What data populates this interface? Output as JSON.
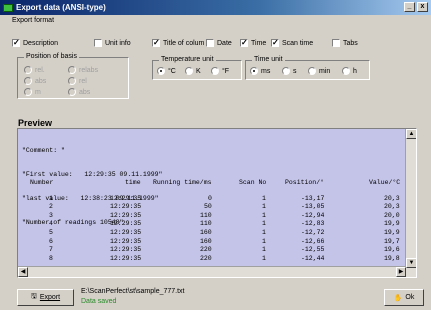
{
  "window": {
    "title": "Export data (ANSI-type)",
    "min": "_",
    "close": "x"
  },
  "menu": {
    "label": "Export format"
  },
  "options": {
    "description": "Description",
    "unit_info": "Unit info",
    "title_of_column": "Title of colum",
    "date": "Date",
    "time": "Time",
    "scan_time": "Scan time",
    "tabs": "Tabs"
  },
  "basis": {
    "title": "Position of basis",
    "items": [
      "rel.",
      "relabs",
      "abs",
      "rel",
      "m",
      "abs"
    ]
  },
  "temp_unit": {
    "title": "Temperature unit",
    "options": [
      "°C",
      "K",
      "°F"
    ],
    "selected": "°C"
  },
  "time_unit": {
    "title": "Time unit",
    "options": [
      "ms",
      "s",
      "min",
      "h"
    ],
    "selected": "ms"
  },
  "preview": {
    "label": "Preview",
    "header_lines": [
      "\"Comment: \"",
      "\"First value:   12:29:35 09.11.1999\"",
      "\"last value:   12:38:23 09.11.1999\"",
      "\"Number of readings 10548\""
    ],
    "columns": [
      "Number",
      "time",
      "Running time/ms",
      "Scan No",
      "Position/°",
      "Value/°C"
    ],
    "rows": [
      [
        "1",
        "12:29:35",
        "0",
        "1",
        "-13,17",
        "20,3"
      ],
      [
        "2",
        "12:29:35",
        "50",
        "1",
        "-13,05",
        "20,3"
      ],
      [
        "3",
        "12:29:35",
        "110",
        "1",
        "-12,94",
        "20,0"
      ],
      [
        "4",
        "12:29:35",
        "110",
        "1",
        "-12,83",
        "19,9"
      ],
      [
        "5",
        "12:29:35",
        "160",
        "1",
        "-12,72",
        "19,9"
      ],
      [
        "6",
        "12:29:35",
        "160",
        "1",
        "-12,66",
        "19,7"
      ],
      [
        "7",
        "12:29:35",
        "220",
        "1",
        "-12,55",
        "19,6"
      ],
      [
        "8",
        "12:29:35",
        "220",
        "1",
        "-12,44",
        "19,8"
      ]
    ]
  },
  "footer": {
    "export_label": "Export",
    "path": "E:\\ScanPerfect\\st\\sample_777.txt",
    "status": "Data saved",
    "ok_label": "Ok"
  }
}
